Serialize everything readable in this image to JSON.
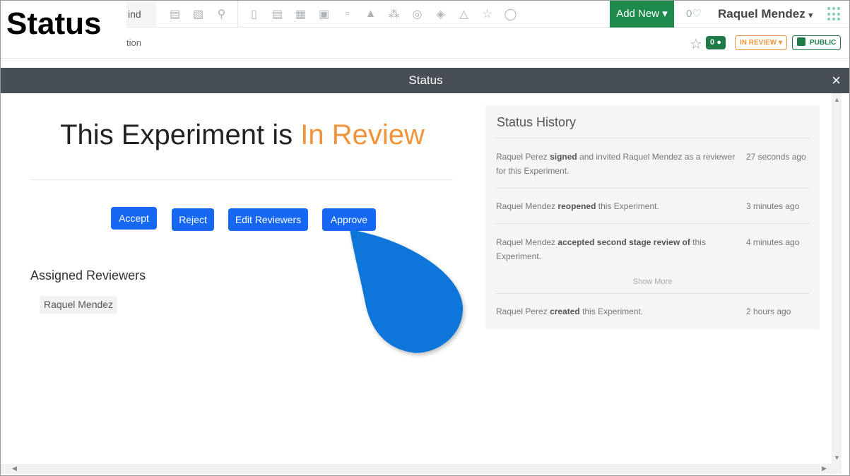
{
  "overlay": {
    "label": "Status"
  },
  "navbar": {
    "find_text": "ind",
    "add_new": "Add New",
    "notifications_count": "0",
    "user_name": "Raquel Mendez",
    "icons": [
      "report-icon",
      "chart-icon",
      "search-icon",
      "notebook-icon",
      "clipboard-icon",
      "calendar-icon",
      "presentation-icon",
      "jar-icon",
      "lab-icon",
      "network-icon",
      "target-icon",
      "shield-icon",
      "flask-icon",
      "star-icon",
      "user-icon"
    ]
  },
  "subbar": {
    "crumb": "tion",
    "comments_count": "0",
    "review_badge": "IN REVIEW",
    "public_badge": "PUBLIC"
  },
  "modal": {
    "title": "Status",
    "close": "×",
    "headline_prefix": "This Experiment is ",
    "headline_status": "In Review",
    "buttons": {
      "accept": "Accept",
      "reject": "Reject",
      "edit_reviewers": "Edit Reviewers",
      "approve": "Approve"
    },
    "assigned_title": "Assigned Reviewers",
    "reviewers": [
      "Raquel Mendez"
    ]
  },
  "history": {
    "title": "Status History",
    "entries": [
      {
        "actor": "Raquel Perez",
        "action": "signed",
        "rest": " and invited Raquel Mendez as a reviewer for this Experiment.",
        "time": "27 seconds ago"
      },
      {
        "actor": "Raquel Mendez",
        "action": "reopened",
        "rest": " this Experiment.",
        "time": "3 minutes ago"
      },
      {
        "actor": "Raquel Mendez",
        "action": "accepted second stage review of",
        "rest": " this Experiment.",
        "time": "4 minutes ago"
      },
      {
        "actor": "Raquel Perez",
        "action": "created",
        "rest": " this Experiment.",
        "time": "2 hours ago"
      }
    ],
    "show_more": "Show More"
  },
  "colors": {
    "primary": "#1668f2",
    "review": "#f0933a",
    "success": "#1e8a4c",
    "header": "#474e55",
    "pointer": "#0a76d8"
  }
}
